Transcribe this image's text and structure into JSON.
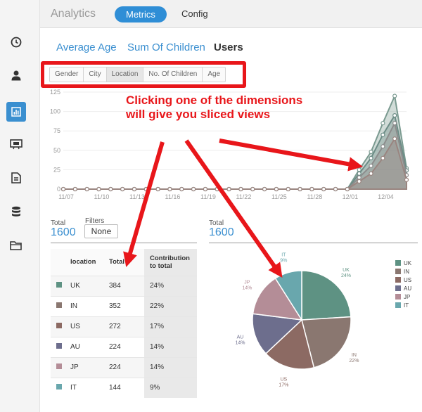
{
  "app": {
    "title": "Analytics"
  },
  "nav": {
    "metrics_label": "Metrics",
    "config_label": "Config"
  },
  "metric_tabs": [
    "Average Age",
    "Sum Of Children",
    "Users"
  ],
  "dimensions": [
    "Gender",
    "City",
    "Location",
    "No. Of Children",
    "Age"
  ],
  "callout": {
    "line1": "Clicking one of the dimensions",
    "line2": "will give you sliced views"
  },
  "left_total": {
    "label": "Total",
    "value": "1600"
  },
  "filters": {
    "label": "Filters",
    "value": "None"
  },
  "right_total": {
    "label": "Total",
    "value": "1600"
  },
  "table": {
    "headers": [
      "location",
      "Total",
      "Contribution to total"
    ],
    "rows": [
      {
        "location": "UK",
        "total": "384",
        "contribution": "24%",
        "color": "#5e9283"
      },
      {
        "location": "IN",
        "total": "352",
        "contribution": "22%",
        "color": "#8a7770"
      },
      {
        "location": "US",
        "total": "272",
        "contribution": "17%",
        "color": "#8c6a63"
      },
      {
        "location": "AU",
        "total": "224",
        "contribution": "14%",
        "color": "#6d6e8d"
      },
      {
        "location": "JP",
        "total": "224",
        "contribution": "14%",
        "color": "#b48d97"
      },
      {
        "location": "IT",
        "total": "144",
        "contribution": "9%",
        "color": "#69a7ad"
      }
    ]
  },
  "chart_data": [
    {
      "type": "area",
      "ylim": [
        0,
        125
      ],
      "y_ticks": [
        "0",
        "25",
        "50",
        "75",
        "100",
        "125"
      ],
      "x_ticks": [
        "11/07",
        "11/10",
        "11/13",
        "11/16",
        "11/19",
        "11/22",
        "11/25",
        "11/28",
        "12/01",
        "12/04"
      ],
      "point_count": 30,
      "series": [
        {
          "values": [
            0,
            0,
            0,
            0,
            0,
            0,
            0,
            0,
            0,
            0,
            0,
            0,
            0,
            0,
            0,
            0,
            0,
            0,
            0,
            0,
            0,
            0,
            0,
            0,
            0,
            20,
            40,
            70,
            95,
            24
          ],
          "color": "#6c8c86"
        },
        {
          "values": [
            0,
            0,
            0,
            0,
            0,
            0,
            0,
            0,
            0,
            0,
            0,
            0,
            0,
            0,
            0,
            0,
            0,
            0,
            0,
            0,
            0,
            0,
            0,
            0,
            0,
            15,
            30,
            55,
            85,
            18
          ],
          "color": "#8c8c8c"
        },
        {
          "values": [
            0,
            0,
            0,
            0,
            0,
            0,
            0,
            0,
            0,
            0,
            0,
            0,
            0,
            0,
            0,
            0,
            0,
            0,
            0,
            0,
            0,
            0,
            0,
            0,
            0,
            10,
            20,
            40,
            65,
            12
          ],
          "color": "#9a8580"
        },
        {
          "values": [
            0,
            0,
            0,
            0,
            0,
            0,
            0,
            0,
            0,
            0,
            0,
            0,
            0,
            0,
            0,
            0,
            0,
            0,
            0,
            0,
            0,
            0,
            0,
            0,
            0,
            25,
            48,
            85,
            120,
            27
          ],
          "color": "#7a9a90"
        }
      ]
    },
    {
      "type": "pie",
      "slices": [
        {
          "label": "UK",
          "value": 24,
          "percent": "24%",
          "color": "#5e9283"
        },
        {
          "label": "IN",
          "value": 22,
          "percent": "22%",
          "color": "#8a7770"
        },
        {
          "label": "US",
          "value": 17,
          "percent": "17%",
          "color": "#8c6a63"
        },
        {
          "label": "AU",
          "value": 14,
          "percent": "14%",
          "color": "#6d6e8d"
        },
        {
          "label": "JP",
          "value": 14,
          "percent": "14%",
          "color": "#b48d97"
        },
        {
          "label": "IT",
          "value": 9,
          "percent": "9%",
          "color": "#69a7ad"
        }
      ],
      "legend_position": "top-right"
    }
  ],
  "colors": {
    "accent": "#2f8ed6",
    "highlight": "#e8161a"
  }
}
